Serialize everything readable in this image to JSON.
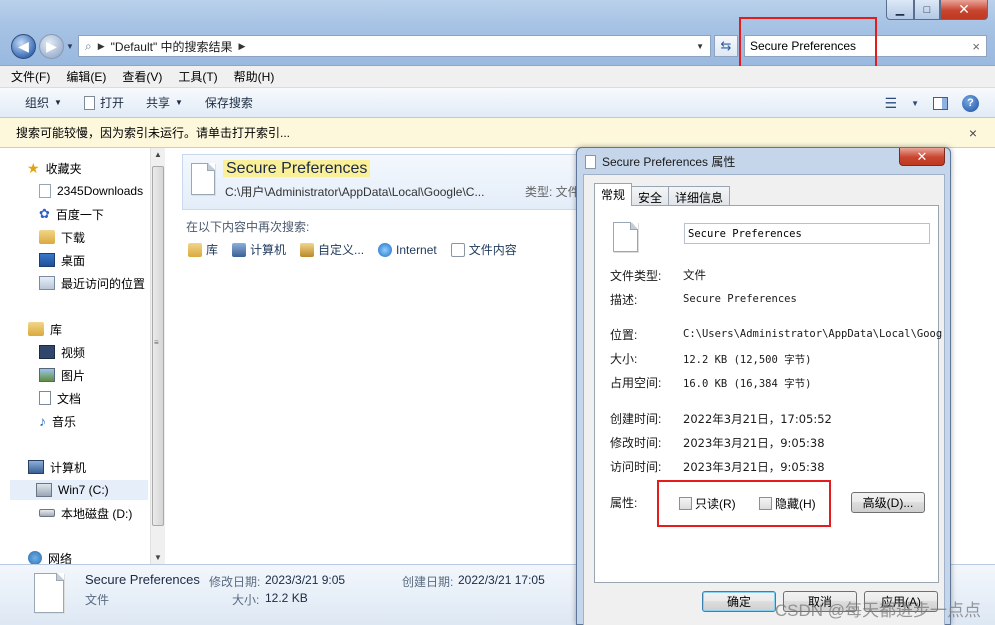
{
  "window": {
    "minimize_glyph": "▁",
    "maximize_glyph": "□",
    "close_glyph": "✕"
  },
  "address": {
    "path_segment": "\"Default\" 中的搜索结果"
  },
  "search": {
    "value": "Secure Preferences",
    "clear_glyph": "×"
  },
  "menu": {
    "items": [
      "文件(F)",
      "编辑(E)",
      "查看(V)",
      "工具(T)",
      "帮助(H)"
    ]
  },
  "commands": {
    "organize": "组织",
    "open": "打开",
    "share": "共享",
    "save_search": "保存搜索"
  },
  "infobar": {
    "message": "搜索可能较慢，因为索引未运行。请单击打开索引...",
    "close_glyph": "×"
  },
  "nav": {
    "favorites": "收藏夹",
    "downloads2345": "2345Downloads",
    "baidu": "百度一下",
    "download": "下载",
    "desktop": "桌面",
    "recent": "最近访问的位置",
    "libraries": "库",
    "videos": "视频",
    "pictures": "图片",
    "documents": "文档",
    "music": "音乐",
    "computer": "计算机",
    "win7c": "Win7 (C:)",
    "localdisk": "本地磁盘 (D:)",
    "network": "网络"
  },
  "result": {
    "title": "Secure Preferences",
    "path": "C:\\用户\\Administrator\\AppData\\Local\\Google\\C...",
    "type_label": "类型: 文件"
  },
  "search_again": {
    "label": "在以下内容中再次搜索:",
    "links": [
      "库",
      "计算机",
      "自定义...",
      "Internet",
      "文件内容"
    ]
  },
  "details": {
    "name": "Secure Preferences",
    "type": "文件",
    "modified_label": "修改日期:",
    "modified_value": "2023/3/21 9:05",
    "size_label": "大小:",
    "size_value": "12.2 KB",
    "created_label": "创建日期:",
    "created_value": "2022/3/21 17:05"
  },
  "dialog": {
    "title": "Secure Preferences 属性",
    "close_glyph": "✕",
    "tabs": [
      "常规",
      "安全",
      "详细信息"
    ],
    "filename": "Secure Preferences",
    "type_label": "文件类型:",
    "type_value": "文件",
    "desc_label": "描述:",
    "desc_value": "Secure Preferences",
    "location_label": "位置:",
    "location_value": "C:\\Users\\Administrator\\AppData\\Local\\Goog",
    "size_label": "大小:",
    "size_value": "12.2 KB (12,500 字节)",
    "disk_label": "占用空间:",
    "disk_value": "16.0 KB (16,384 字节)",
    "created_label": "创建时间:",
    "created_value": "2022年3月21日，17:05:52",
    "modified_label": "修改时间:",
    "modified_value": "2023年3月21日，9:05:38",
    "accessed_label": "访问时间:",
    "accessed_value": "2023年3月21日，9:05:38",
    "attr_label": "属性:",
    "readonly_label": "只读(R)",
    "hidden_label": "隐藏(H)",
    "advanced_label": "高级(D)...",
    "ok_label": "确定",
    "cancel_label": "取消",
    "apply_label": "应用(A)"
  },
  "watermark": "CSDN @每天都进步一点点"
}
